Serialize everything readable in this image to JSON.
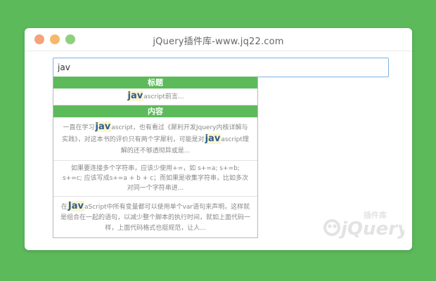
{
  "window": {
    "title": "jQuery插件库-www.jq22.com"
  },
  "search": {
    "value": "jav"
  },
  "dropdown": {
    "title_header": "标题",
    "title_items": [
      {
        "match": "jav",
        "rest": "ascript前言..."
      }
    ],
    "content_header": "内容",
    "content_items": [
      {
        "before": "一直在学习",
        "match": "jav",
        "after": "ascript，也有看过《犀利开发Jquery内核详解与实践》，对这本书的评价只有两个字犀利，可能是对",
        "match2": "jav",
        "after2": "ascript理解的还不够透彻异或是..."
      },
      {
        "text": "如果要连接多个字符串，应该少使用+=，如 s+=a; s+=b; s+=c; 应该写成s+=a + b + c；而如果是收集字符串，比如多次对同一个字符串进..."
      },
      {
        "before": "在",
        "match": "Jav",
        "after": "aScript中所有变量都可以使用单个var语句来声明，这样就是组合在一起的语句，以减少整个脚本的执行时间，就如上面代码一样，上面代码格式也挺规范，让人..."
      }
    ]
  },
  "logo": {
    "text": "jQuery",
    "tagline": "插件库"
  },
  "colors": {
    "background": "#5dba5b",
    "accent": "#5dba5b",
    "highlight_text": "#2e5d8f",
    "highlight_bg": "#fbf5d0"
  }
}
